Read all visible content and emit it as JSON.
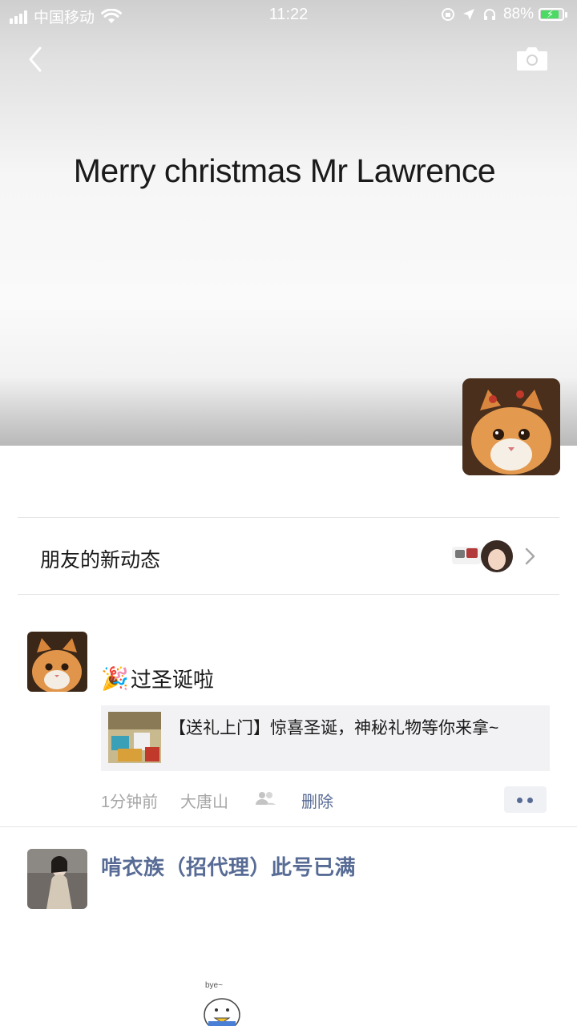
{
  "status_bar": {
    "carrier": "中国移动",
    "time": "11:22",
    "battery": "88%",
    "battery_level": 0.88
  },
  "header": {
    "back_icon": "chevron-left-icon",
    "camera_icon": "camera-icon"
  },
  "cover": {
    "title": "Merry christmas Mr Lawrence"
  },
  "friends_updates": {
    "label": "朋友的新动态"
  },
  "posts": [
    {
      "emoji": "🎉",
      "text": "过圣诞啦",
      "link_title": "【送礼上门】惊喜圣诞，神秘礼物等你来拿~",
      "time": "1分钟前",
      "location": "大唐山",
      "privacy_icon": "friends-visible-icon",
      "delete_label": "删除",
      "more_icon": "more-dots-icon"
    },
    {
      "name": "啃衣族（招代理）此号已满"
    }
  ],
  "colors": {
    "link_blue": "#576b95",
    "battery_green": "#4cd964"
  }
}
